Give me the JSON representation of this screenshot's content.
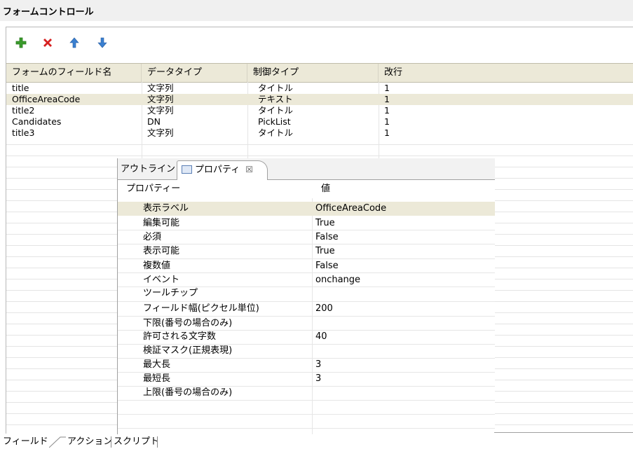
{
  "window": {
    "title": "フォームコントロール"
  },
  "toolbar": {
    "buttons": [
      "add-icon",
      "delete-icon",
      "move-up-icon",
      "move-down-icon"
    ]
  },
  "grid": {
    "columns": [
      "フォームのフィールド名",
      "データタイプ",
      "制御タイプ",
      "改行"
    ],
    "rows": [
      {
        "name": "title",
        "datatype": "文字列",
        "control": "タイトル",
        "linebreak": "1"
      },
      {
        "name": "OfficeAreaCode",
        "datatype": "文字列",
        "control": "テキスト",
        "linebreak": "1"
      },
      {
        "name": "title2",
        "datatype": "文字列",
        "control": "タイトル",
        "linebreak": "1"
      },
      {
        "name": "Candidates",
        "datatype": "DN",
        "control": "PickList",
        "linebreak": "1"
      },
      {
        "name": "title3",
        "datatype": "文字列",
        "control": "タイトル",
        "linebreak": "1"
      }
    ]
  },
  "properties": {
    "tabs": {
      "outline": "アウトライン",
      "properties": "プロパティ",
      "close": "☒"
    },
    "headers": {
      "property": "プロパティー",
      "value": "値"
    },
    "rows": [
      {
        "name": "表示ラベル",
        "value": "OfficeAreaCode"
      },
      {
        "name": "編集可能",
        "value": "True"
      },
      {
        "name": "必須",
        "value": "False"
      },
      {
        "name": "表示可能",
        "value": "True"
      },
      {
        "name": "複数値",
        "value": "False"
      },
      {
        "name": "イベント",
        "value": "onchange"
      },
      {
        "name": "ツールチップ",
        "value": ""
      },
      {
        "name": "フィールド幅(ピクセル単位)",
        "value": "200"
      },
      {
        "name": "下限(番号の場合のみ)",
        "value": ""
      },
      {
        "name": "許可される文字数",
        "value": "40"
      },
      {
        "name": "検証マスク(正規表現)",
        "value": ""
      },
      {
        "name": "最大長",
        "value": "3"
      },
      {
        "name": "最短長",
        "value": "3"
      },
      {
        "name": "上限(番号の場合のみ)",
        "value": ""
      }
    ]
  },
  "bottom_tabs": [
    "フィールド",
    "アクション",
    "スクリプト"
  ],
  "colors": {
    "selected_row": "#ece9d8",
    "header_bg": "#ece9d8",
    "add": "#3a9b2b",
    "delete": "#d62020",
    "arrows": "#3a7fd0"
  }
}
